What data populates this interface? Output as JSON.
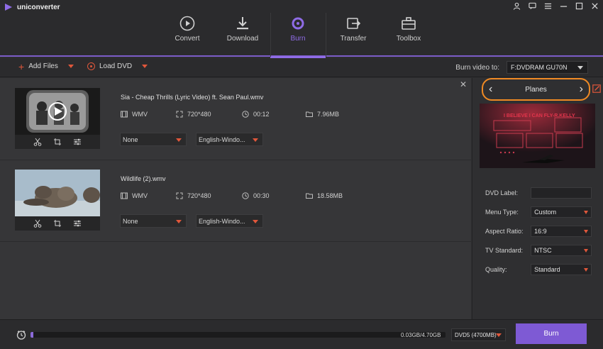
{
  "app": {
    "title": "uniconverter",
    "accent": "#8f6ce6",
    "brand_orange": "#f08a24"
  },
  "nav": [
    {
      "label": "Convert",
      "icon": "convert-icon",
      "active": false
    },
    {
      "label": "Download",
      "icon": "download-icon",
      "active": false
    },
    {
      "label": "Burn",
      "icon": "burn-icon",
      "active": true
    },
    {
      "label": "Transfer",
      "icon": "transfer-icon",
      "active": false
    },
    {
      "label": "Toolbox",
      "icon": "toolbox-icon",
      "active": false
    }
  ],
  "toolbar": {
    "add_files": "Add Files",
    "load_dvd": "Load DVD",
    "burn_to_label": "Burn video to:",
    "burn_to_value": "F:DVDRAM GU70N"
  },
  "files": [
    {
      "name": "Sia - Cheap Thrills (Lyric Video) ft. Sean Paul.wmv",
      "format": "WMV",
      "resolution": "720*480",
      "duration": "00:12",
      "size": "7.96MB",
      "subtitle": "None",
      "audio": "English-Windo..."
    },
    {
      "name": "Wildlife (2).wmv",
      "format": "WMV",
      "resolution": "720*480",
      "duration": "00:30",
      "size": "18.58MB",
      "subtitle": "None",
      "audio": "English-Windo..."
    }
  ],
  "panel": {
    "template_name": "Planes",
    "preview_title": "I BELIEVE I CAN FLY-R.KELLY",
    "dvd_label_label": "DVD Label:",
    "dvd_label_value": "",
    "menu_type_label": "Menu Type:",
    "menu_type_value": "Custom",
    "aspect_ratio_label": "Aspect Ratio:",
    "aspect_ratio_value": "16:9",
    "tv_standard_label": "TV Standard:",
    "tv_standard_value": "NTSC",
    "quality_label": "Quality:",
    "quality_value": "Standard"
  },
  "bottom": {
    "progress_text": "0.03GB/4.70GB",
    "progress_fraction": 0.006,
    "disc_type": "DVD5 (4700MB)",
    "burn_button": "Burn"
  }
}
